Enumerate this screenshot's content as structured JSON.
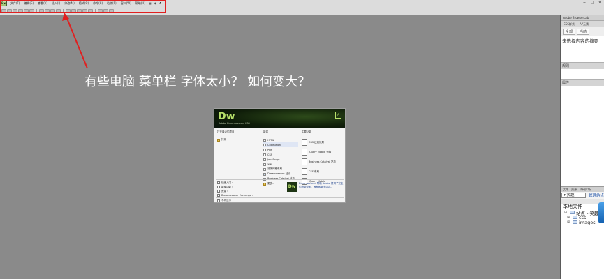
{
  "menubar": {
    "app_logo": "Dw",
    "items": [
      "文件(F)",
      "编辑(E)",
      "查看(V)",
      "插入(I)",
      "修改(M)",
      "格式(O)",
      "命令(C)",
      "站点(S)",
      "窗口(W)",
      "帮助(H)"
    ],
    "tools": [
      "▦",
      "◈",
      "♣"
    ],
    "window_controls": [
      "−",
      "□",
      "×"
    ]
  },
  "annotation": {
    "text": "有些电脑 菜单栏 字体太小？ 如何变大？",
    "arrow_color": "#e02020",
    "box_color": "#e02020"
  },
  "welcome": {
    "logo": "Dw",
    "product": "Adobe Dreamweaver CS6",
    "adobe": "A",
    "recent_title": "打开最近的项目",
    "recent_items": [
      "打开..."
    ],
    "create_title": "新建",
    "create_items": [
      "HTML",
      "ColdFusion",
      "PHP",
      "CSS",
      "JavaScript",
      "XML",
      "流体网格布局...",
      "Dreamweaver 站点...",
      "Business Catalyst 站点",
      "更多..."
    ],
    "samples_title": "主要功能",
    "samples_items": [
      "CSS 过渡效果",
      "jQuery Mobile 色板",
      "Business Catalyst 站点",
      "CSS 布局",
      "jQuery Mobile",
      "PhoneGap Build 面板",
      "更多"
    ],
    "bottom_links": [
      "快速入门 »",
      "新增功能 »",
      "资源 »",
      "Dreamweaver Exchange »"
    ],
    "promo_text": "Dreamweaver 帮助 Adobe 提供了完全的功能说明、教程和更多内容。",
    "footer_checkbox": "不再显示"
  },
  "right_panel": {
    "title": "Adobe BrowserLab",
    "tabs": [
      "CSS样式",
      "AP元素"
    ],
    "subtabs": [
      "全部",
      "当前"
    ],
    "no_selection": "未选择内容的摘要",
    "sections": [
      "规则",
      "属性"
    ],
    "files_tabs": [
      "文件",
      "资源",
      "代码片断"
    ],
    "site_select": "▾ 笑趣",
    "files_link": "管理站点",
    "local_files": "本地文件",
    "tree": [
      "站点 - 笑趣",
      "css",
      "images"
    ]
  }
}
